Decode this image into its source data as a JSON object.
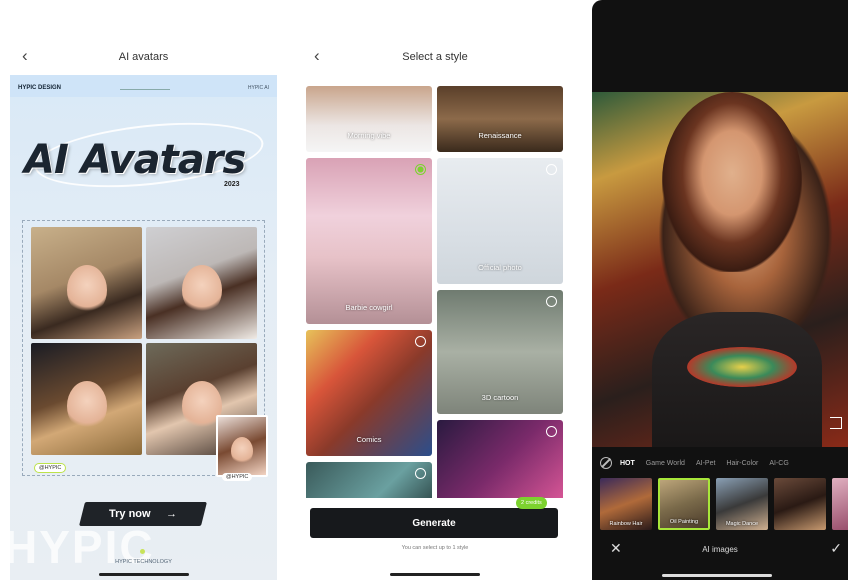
{
  "screen1": {
    "nav_title": "AI avatars",
    "back_glyph": "‹",
    "brand_left": "HYPIC DESIGN",
    "brand_right": "HYPIC AI",
    "headline": "AI Avatars",
    "year": "2023",
    "tag_left": "@HYPIC",
    "tag_right": "@HYPIC",
    "try_label": "Try now",
    "try_arrow": "→",
    "watermark": "HYPIC",
    "tech_text": "HYPIC TECHNOLOGY"
  },
  "screen2": {
    "nav_title": "Select a style",
    "back_glyph": "‹",
    "styles": [
      {
        "label": "Morning vibe",
        "selected": false
      },
      {
        "label": "Renaissance",
        "selected": false
      },
      {
        "label": "Barbie cowgirl",
        "selected": true
      },
      {
        "label": "Official photo",
        "selected": false
      },
      {
        "label": "3D cartoon",
        "selected": false
      },
      {
        "label": "Comics",
        "selected": false
      },
      {
        "label": "",
        "selected": false
      },
      {
        "label": "",
        "selected": false
      }
    ],
    "generate_label": "Generate",
    "credits_badge": "2 credits",
    "hint": "You can select up to 1 style"
  },
  "screen3": {
    "categories": [
      "HOT",
      "Game World",
      "AI-Pet",
      "Hair-Color",
      "AI-CG"
    ],
    "active_category": "HOT",
    "thumbnails": [
      {
        "label": "Rainbow Hair",
        "selected": false
      },
      {
        "label": "Oil Painting",
        "selected": true
      },
      {
        "label": "Magic Dance",
        "selected": false
      },
      {
        "label": "",
        "selected": false
      },
      {
        "label": "",
        "selected": false
      }
    ],
    "bottom_label": "AI images",
    "close_glyph": "✕",
    "confirm_glyph": "✓"
  },
  "colors": {
    "accent_green": "#7cd22e",
    "dark_button": "#17191c"
  }
}
